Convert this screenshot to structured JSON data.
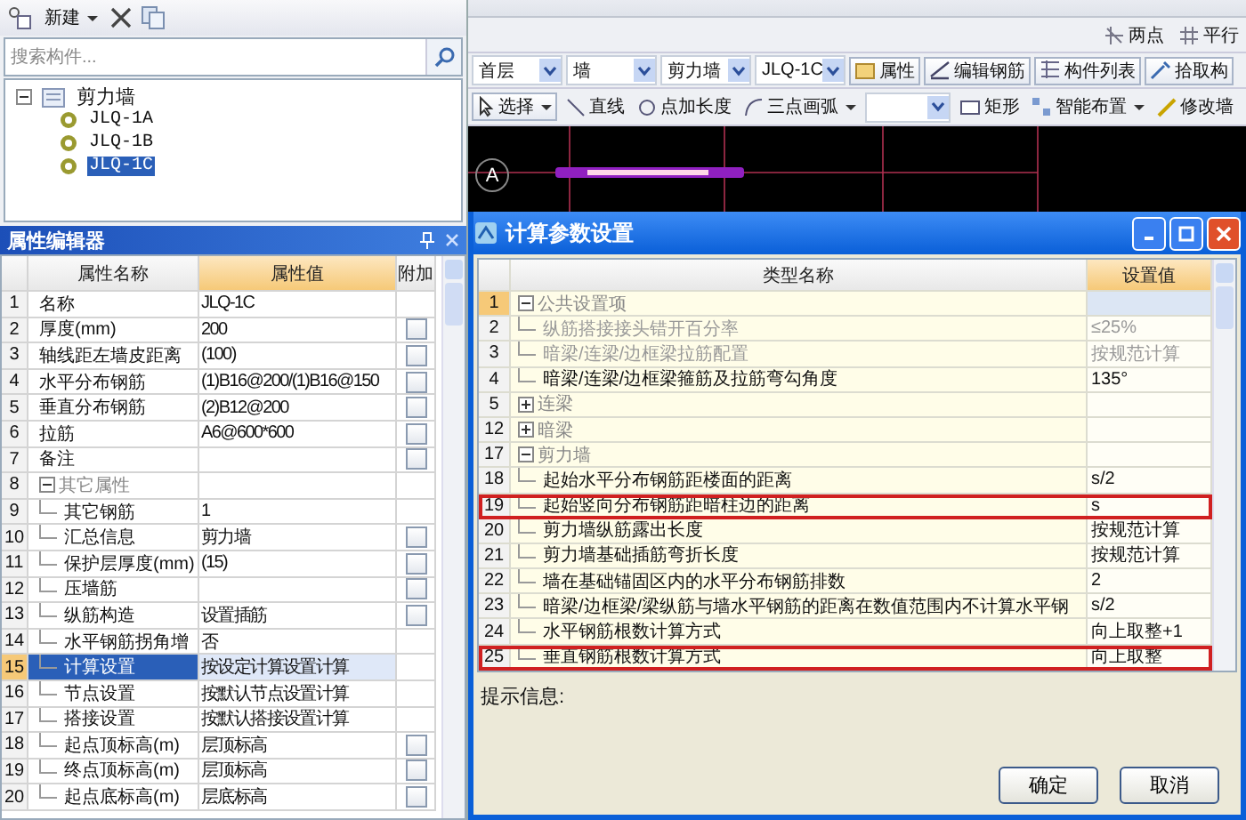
{
  "left_toolbar": {
    "new_button": "新建"
  },
  "search": {
    "placeholder": "搜索构件..."
  },
  "tree": [
    {
      "label": "剪力墙",
      "expanded": true,
      "selected": false,
      "children": [
        {
          "label": "JLQ-1A",
          "selected": false
        },
        {
          "label": "JLQ-1B",
          "selected": false
        },
        {
          "label": "JLQ-1C",
          "selected": true
        }
      ]
    }
  ],
  "property_editor": {
    "title": "属性编辑器",
    "columns": [
      "属性名称",
      "属性值",
      "附加"
    ],
    "rows": [
      {
        "num": "1",
        "kind": "item",
        "name": "名称",
        "value": "JLQ-1C",
        "selected": false
      },
      {
        "num": "2",
        "kind": "item",
        "name": "厚度(mm)",
        "value": "200",
        "selected": false,
        "checked": false
      },
      {
        "num": "3",
        "kind": "item",
        "name": "轴线距左墙皮距离",
        "value": "(100)",
        "selected": false,
        "checked": false
      },
      {
        "num": "4",
        "kind": "item",
        "name": "水平分布钢筋",
        "value": "(1)B16@200/(1)B16@150",
        "selected": false,
        "checked": false
      },
      {
        "num": "5",
        "kind": "item",
        "name": "垂直分布钢筋",
        "value": "(2)B12@200",
        "selected": false,
        "checked": false
      },
      {
        "num": "6",
        "kind": "item",
        "name": "拉筋",
        "value": "A6@600*600",
        "selected": false,
        "checked": false
      },
      {
        "num": "7",
        "kind": "item",
        "name": "备注",
        "selected": false,
        "checked": false
      },
      {
        "num": "8",
        "kind": "group",
        "name": "其它属性",
        "expanded": true,
        "selected": false,
        "children": [
          {
            "num": "9",
            "kind": "item",
            "name": "其它钢筋",
            "value": "1",
            "selected": false
          },
          {
            "num": "10",
            "kind": "item",
            "name": "汇总信息",
            "value": "剪力墙",
            "selected": false,
            "checked": false
          },
          {
            "num": "11",
            "kind": "item",
            "name": "保护层厚度(mm)",
            "value": "(15)",
            "selected": false,
            "checked": false
          },
          {
            "num": "12",
            "kind": "item",
            "name": "压墙筋",
            "selected": false,
            "checked": false
          },
          {
            "num": "13",
            "kind": "item",
            "name": "纵筋构造",
            "value": "设置插筋",
            "selected": false,
            "checked": false
          },
          {
            "num": "14",
            "kind": "item",
            "name": "水平钢筋拐角增",
            "value": "否",
            "selected": false
          },
          {
            "num": "15",
            "kind": "item",
            "name": "计算设置",
            "value": "按设定计算设置计算",
            "selected": true
          },
          {
            "num": "16",
            "kind": "item",
            "name": "节点设置",
            "value": "按默认节点设置计算",
            "selected": false
          },
          {
            "num": "17",
            "kind": "item",
            "name": "搭接设置",
            "value": "按默认搭接设置计算",
            "selected": false
          },
          {
            "num": "18",
            "kind": "item",
            "name": "起点顶标高(m)",
            "value": "层顶标高",
            "selected": false,
            "checked": false
          },
          {
            "num": "19",
            "kind": "item",
            "name": "终点顶标高(m)",
            "value": "层顶标高",
            "selected": false,
            "checked": false
          },
          {
            "num": "20",
            "kind": "item",
            "name": "起点底标高(m)",
            "value": "层底标高",
            "selected": false,
            "checked": false
          }
        ]
      }
    ]
  },
  "toolbar_top": [
    "两点",
    "平行"
  ],
  "toolbar_selectors": {
    "dropdowns": [
      "首层",
      "墙",
      "剪力墙",
      "JLQ-1C"
    ],
    "buttons": [
      "属性",
      "编辑钢筋",
      "构件列表",
      "拾取构"
    ]
  },
  "toolbar_draw": [
    {
      "kind": "menu",
      "label": "选择"
    },
    {
      "kind": "button",
      "label": "直线"
    },
    {
      "kind": "button",
      "label": "点加长度"
    },
    {
      "kind": "menu",
      "label": "三点画弧"
    },
    {
      "kind": "combo"
    },
    {
      "kind": "button",
      "label": "矩形"
    },
    {
      "kind": "menu",
      "label": "智能布置"
    },
    {
      "kind": "button",
      "label": "修改墙"
    }
  ],
  "canvas": {
    "axis_label": "A"
  },
  "dialog": {
    "title": "计算参数设置",
    "columns": [
      "类型名称",
      "设置值"
    ],
    "rows": [
      {
        "num": "1",
        "kind": "group",
        "name": "公共设置项",
        "expanded": true,
        "selected": true,
        "children": [
          {
            "num": "2",
            "kind": "item",
            "name": "纵筋搭接接头错开百分率",
            "value": "≤25%",
            "disabled": true,
            "outlined": false,
            "selected": false
          },
          {
            "num": "3",
            "kind": "item",
            "name": "暗梁/连梁/边框梁拉筋配置",
            "value": "按规范计算",
            "disabled": true,
            "outlined": false,
            "selected": false
          },
          {
            "num": "4",
            "kind": "item",
            "name": "暗梁/连梁/边框梁箍筋及拉筋弯勾角度",
            "value": "135°",
            "disabled": false,
            "outlined": false,
            "selected": false
          }
        ]
      },
      {
        "num": "5",
        "kind": "group",
        "name": "连梁",
        "expanded": false,
        "selected": false
      },
      {
        "num": "12",
        "kind": "group",
        "name": "暗梁",
        "expanded": false,
        "selected": false
      },
      {
        "num": "17",
        "kind": "group",
        "name": "剪力墙",
        "expanded": true,
        "selected": false,
        "children": [
          {
            "num": "18",
            "kind": "item",
            "name": "起始水平分布钢筋距楼面的距离",
            "value": "s/2",
            "disabled": false,
            "outlined": false,
            "selected": false
          },
          {
            "num": "19",
            "kind": "item",
            "name": "起始竖向分布钢筋距暗柱边的距离",
            "value": "s",
            "disabled": false,
            "outlined": true,
            "selected": false
          },
          {
            "num": "20",
            "kind": "item",
            "name": "剪力墙纵筋露出长度",
            "value": "按规范计算",
            "disabled": false,
            "outlined": false,
            "selected": false
          },
          {
            "num": "21",
            "kind": "item",
            "name": "剪力墙基础插筋弯折长度",
            "value": "按规范计算",
            "disabled": false,
            "outlined": false,
            "selected": false
          },
          {
            "num": "22",
            "kind": "item",
            "name": "墙在基础锚固区内的水平分布钢筋排数",
            "value": "2",
            "disabled": false,
            "outlined": false,
            "selected": false
          },
          {
            "num": "23",
            "kind": "item",
            "name": "暗梁/边框梁/梁纵筋与墙水平钢筋的距离在数值范围内不计算水平钢",
            "value": "s/2",
            "disabled": false,
            "outlined": false,
            "selected": false
          },
          {
            "num": "24",
            "kind": "item",
            "name": "水平钢筋根数计算方式",
            "value": "向上取整+1",
            "disabled": false,
            "outlined": false,
            "selected": false
          },
          {
            "num": "25",
            "kind": "item",
            "name": "垂直钢筋根数计算方式",
            "value": "向上取整",
            "disabled": false,
            "outlined": true,
            "selected": false
          }
        ]
      }
    ],
    "hint_label": "提示信息:",
    "buttons": [
      "确定",
      "取消"
    ]
  }
}
